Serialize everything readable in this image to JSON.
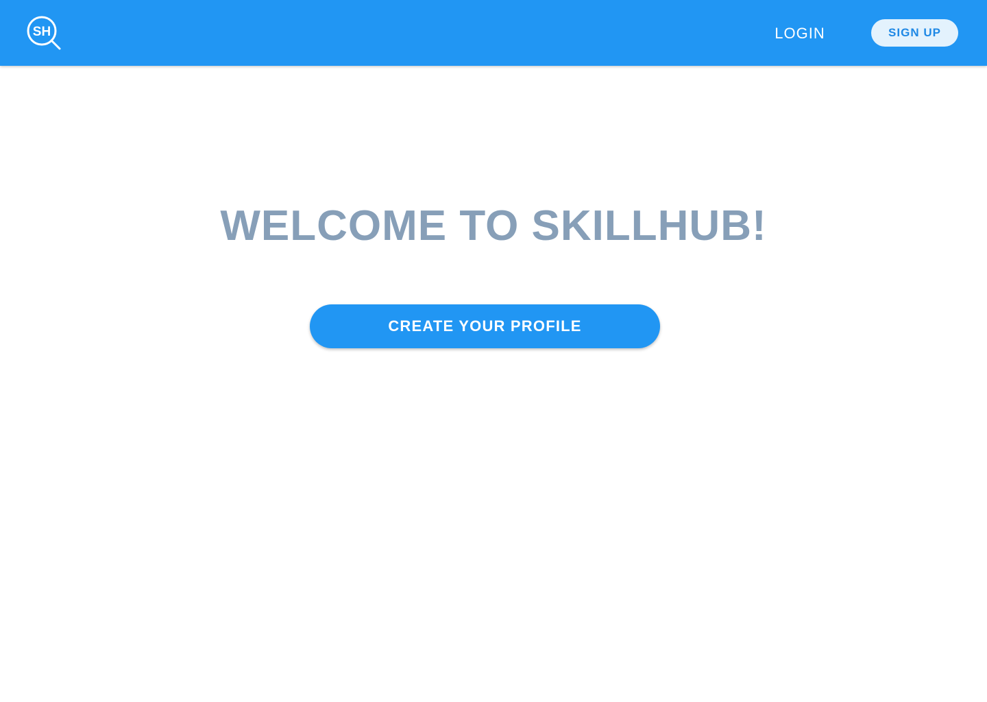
{
  "header": {
    "logo_text": "SH",
    "logo_icon": "magnifier-logo-icon",
    "login_label": "LOGIN",
    "signup_label": "SIGN UP"
  },
  "main": {
    "title": "WELCOME TO SKILLHUB!",
    "cta_label": "CREATE YOUR PROFILE"
  },
  "colors": {
    "header_bg": "#2196F3",
    "signup_bg": "#E3F2FD",
    "signup_text": "#1E88E5",
    "title_text": "#879FB8",
    "cta_bg": "#2196F3",
    "page_bg": "#FFFFFF"
  }
}
